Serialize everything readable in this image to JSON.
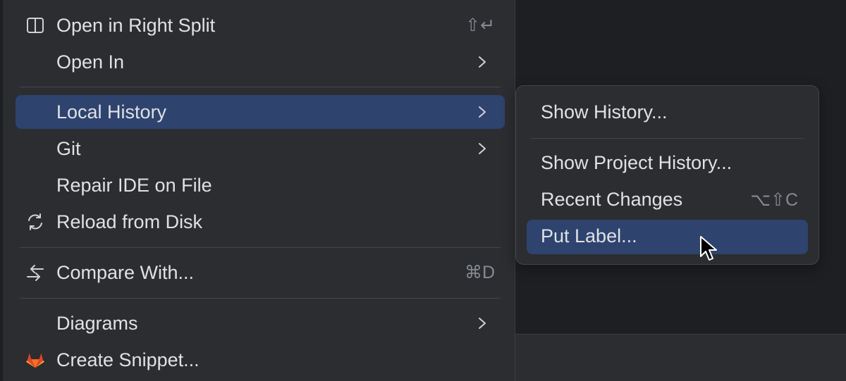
{
  "menu": {
    "items": [
      {
        "label": "Open in Right Split",
        "icon": "split-right-icon",
        "shortcut": "⇧↵"
      },
      {
        "label": "Open In",
        "submenu": true
      },
      {
        "label": "Local History",
        "submenu": true,
        "selected": true
      },
      {
        "label": "Git",
        "submenu": true
      },
      {
        "label": "Repair IDE on File"
      },
      {
        "label": "Reload from Disk",
        "icon": "reload-icon"
      },
      {
        "label": "Compare With...",
        "icon": "compare-arrows-icon",
        "shortcut": "⌘D"
      },
      {
        "label": "Diagrams",
        "submenu": true
      },
      {
        "label": "Create Snippet...",
        "icon": "gitlab-icon"
      }
    ]
  },
  "submenu": {
    "items": [
      {
        "label": "Show History..."
      },
      {
        "label": "Show Project History..."
      },
      {
        "label": "Recent Changes",
        "shortcut": "⌥⇧C"
      },
      {
        "label": "Put Label...",
        "selected": true
      }
    ]
  },
  "colors": {
    "background": "#2b2d30",
    "selection": "#2e436e",
    "text": "#dfe1e5",
    "shortcut_text": "#868a91",
    "separator": "#43454a",
    "gitlab_orange": "#e24329"
  }
}
